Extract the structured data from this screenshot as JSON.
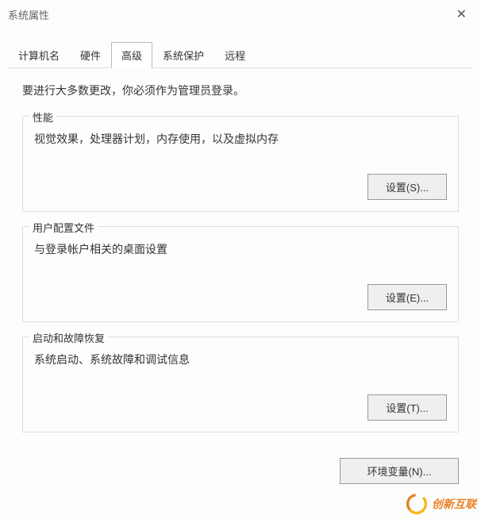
{
  "window": {
    "title": "系统属性"
  },
  "tabs": {
    "computer_name": "计算机名",
    "hardware": "硬件",
    "advanced": "高级",
    "system_protection": "系统保护",
    "remote": "远程",
    "active": "advanced"
  },
  "intro": "要进行大多数更改，你必须作为管理员登录。",
  "groups": {
    "performance": {
      "legend": "性能",
      "desc": "视觉效果，处理器计划，内存使用，以及虚拟内存",
      "button": "设置(S)..."
    },
    "user_profiles": {
      "legend": "用户配置文件",
      "desc": "与登录帐户相关的桌面设置",
      "button": "设置(E)..."
    },
    "startup_recovery": {
      "legend": "启动和故障恢复",
      "desc": "系统启动、系统故障和调试信息",
      "button": "设置(T)..."
    }
  },
  "env_button": "环境变量(N)...",
  "watermark": "创新互联"
}
